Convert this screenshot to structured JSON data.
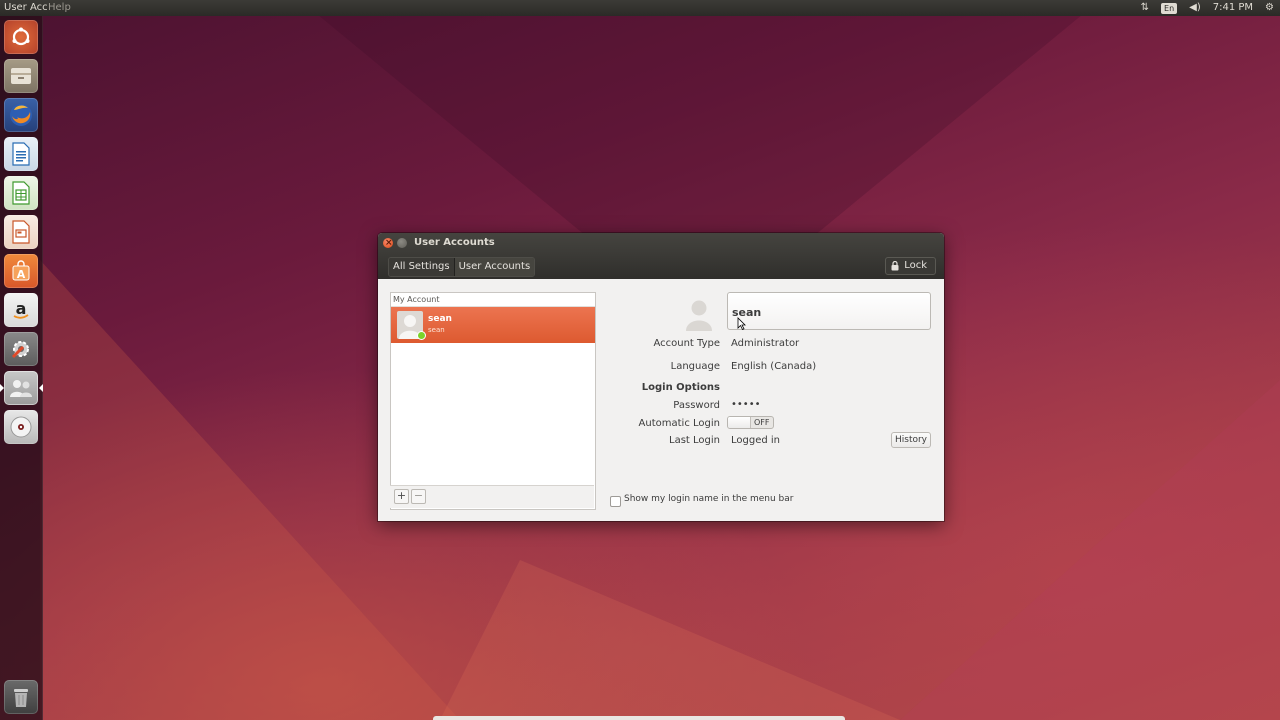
{
  "top_panel": {
    "app_title": "User Acc",
    "menu_help": "Help",
    "indicators": {
      "language": "En",
      "time": "7:41 PM"
    }
  },
  "launcher": {
    "items": [
      "dash-home",
      "files",
      "firefox",
      "libreoffice-writer",
      "libreoffice-calc",
      "libreoffice-impress",
      "ubuntu-software-center",
      "amazon",
      "system-settings",
      "user-accounts",
      "dvd",
      "trash"
    ]
  },
  "window": {
    "title": "User Accounts",
    "breadcrumb": [
      "All Settings",
      "User Accounts"
    ],
    "lock_label": "Lock"
  },
  "user_list": {
    "header": "My Account",
    "users": [
      {
        "name": "sean",
        "login": "sean"
      }
    ],
    "add_label": "+",
    "remove_label": "−"
  },
  "details": {
    "name": "sean",
    "account_type_label": "Account Type",
    "account_type_value": "Administrator",
    "language_label": "Language",
    "language_value": "English (Canada)",
    "login_options_title": "Login Options",
    "password_label": "Password",
    "password_value": "•••••",
    "auto_login_label": "Automatic Login",
    "auto_login_state": "OFF",
    "last_login_label": "Last Login",
    "last_login_value": "Logged in",
    "history_label": "History",
    "show_login_name_label": "Show my login name in the menu bar"
  },
  "colors": {
    "accent": "#dd5a30",
    "panel": "#3c3b37",
    "window_bg": "#f2f1f0"
  }
}
